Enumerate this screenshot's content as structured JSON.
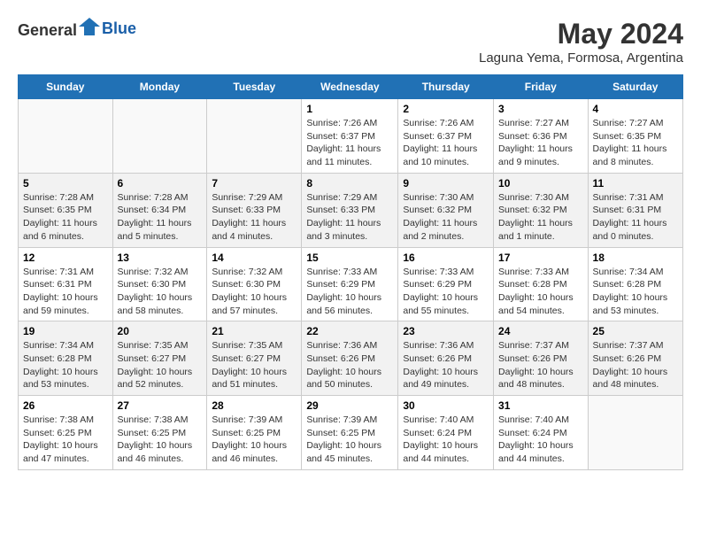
{
  "header": {
    "logo_general": "General",
    "logo_blue": "Blue",
    "title": "May 2024",
    "subtitle": "Laguna Yema, Formosa, Argentina"
  },
  "columns": [
    "Sunday",
    "Monday",
    "Tuesday",
    "Wednesday",
    "Thursday",
    "Friday",
    "Saturday"
  ],
  "weeks": [
    {
      "days": [
        {
          "num": "",
          "info": ""
        },
        {
          "num": "",
          "info": ""
        },
        {
          "num": "",
          "info": ""
        },
        {
          "num": "1",
          "info": "Sunrise: 7:26 AM\nSunset: 6:37 PM\nDaylight: 11 hours and 11 minutes."
        },
        {
          "num": "2",
          "info": "Sunrise: 7:26 AM\nSunset: 6:37 PM\nDaylight: 11 hours and 10 minutes."
        },
        {
          "num": "3",
          "info": "Sunrise: 7:27 AM\nSunset: 6:36 PM\nDaylight: 11 hours and 9 minutes."
        },
        {
          "num": "4",
          "info": "Sunrise: 7:27 AM\nSunset: 6:35 PM\nDaylight: 11 hours and 8 minutes."
        }
      ]
    },
    {
      "days": [
        {
          "num": "5",
          "info": "Sunrise: 7:28 AM\nSunset: 6:35 PM\nDaylight: 11 hours and 6 minutes."
        },
        {
          "num": "6",
          "info": "Sunrise: 7:28 AM\nSunset: 6:34 PM\nDaylight: 11 hours and 5 minutes."
        },
        {
          "num": "7",
          "info": "Sunrise: 7:29 AM\nSunset: 6:33 PM\nDaylight: 11 hours and 4 minutes."
        },
        {
          "num": "8",
          "info": "Sunrise: 7:29 AM\nSunset: 6:33 PM\nDaylight: 11 hours and 3 minutes."
        },
        {
          "num": "9",
          "info": "Sunrise: 7:30 AM\nSunset: 6:32 PM\nDaylight: 11 hours and 2 minutes."
        },
        {
          "num": "10",
          "info": "Sunrise: 7:30 AM\nSunset: 6:32 PM\nDaylight: 11 hours and 1 minute."
        },
        {
          "num": "11",
          "info": "Sunrise: 7:31 AM\nSunset: 6:31 PM\nDaylight: 11 hours and 0 minutes."
        }
      ]
    },
    {
      "days": [
        {
          "num": "12",
          "info": "Sunrise: 7:31 AM\nSunset: 6:31 PM\nDaylight: 10 hours and 59 minutes."
        },
        {
          "num": "13",
          "info": "Sunrise: 7:32 AM\nSunset: 6:30 PM\nDaylight: 10 hours and 58 minutes."
        },
        {
          "num": "14",
          "info": "Sunrise: 7:32 AM\nSunset: 6:30 PM\nDaylight: 10 hours and 57 minutes."
        },
        {
          "num": "15",
          "info": "Sunrise: 7:33 AM\nSunset: 6:29 PM\nDaylight: 10 hours and 56 minutes."
        },
        {
          "num": "16",
          "info": "Sunrise: 7:33 AM\nSunset: 6:29 PM\nDaylight: 10 hours and 55 minutes."
        },
        {
          "num": "17",
          "info": "Sunrise: 7:33 AM\nSunset: 6:28 PM\nDaylight: 10 hours and 54 minutes."
        },
        {
          "num": "18",
          "info": "Sunrise: 7:34 AM\nSunset: 6:28 PM\nDaylight: 10 hours and 53 minutes."
        }
      ]
    },
    {
      "days": [
        {
          "num": "19",
          "info": "Sunrise: 7:34 AM\nSunset: 6:28 PM\nDaylight: 10 hours and 53 minutes."
        },
        {
          "num": "20",
          "info": "Sunrise: 7:35 AM\nSunset: 6:27 PM\nDaylight: 10 hours and 52 minutes."
        },
        {
          "num": "21",
          "info": "Sunrise: 7:35 AM\nSunset: 6:27 PM\nDaylight: 10 hours and 51 minutes."
        },
        {
          "num": "22",
          "info": "Sunrise: 7:36 AM\nSunset: 6:26 PM\nDaylight: 10 hours and 50 minutes."
        },
        {
          "num": "23",
          "info": "Sunrise: 7:36 AM\nSunset: 6:26 PM\nDaylight: 10 hours and 49 minutes."
        },
        {
          "num": "24",
          "info": "Sunrise: 7:37 AM\nSunset: 6:26 PM\nDaylight: 10 hours and 48 minutes."
        },
        {
          "num": "25",
          "info": "Sunrise: 7:37 AM\nSunset: 6:26 PM\nDaylight: 10 hours and 48 minutes."
        }
      ]
    },
    {
      "days": [
        {
          "num": "26",
          "info": "Sunrise: 7:38 AM\nSunset: 6:25 PM\nDaylight: 10 hours and 47 minutes."
        },
        {
          "num": "27",
          "info": "Sunrise: 7:38 AM\nSunset: 6:25 PM\nDaylight: 10 hours and 46 minutes."
        },
        {
          "num": "28",
          "info": "Sunrise: 7:39 AM\nSunset: 6:25 PM\nDaylight: 10 hours and 46 minutes."
        },
        {
          "num": "29",
          "info": "Sunrise: 7:39 AM\nSunset: 6:25 PM\nDaylight: 10 hours and 45 minutes."
        },
        {
          "num": "30",
          "info": "Sunrise: 7:40 AM\nSunset: 6:24 PM\nDaylight: 10 hours and 44 minutes."
        },
        {
          "num": "31",
          "info": "Sunrise: 7:40 AM\nSunset: 6:24 PM\nDaylight: 10 hours and 44 minutes."
        },
        {
          "num": "",
          "info": ""
        }
      ]
    }
  ]
}
